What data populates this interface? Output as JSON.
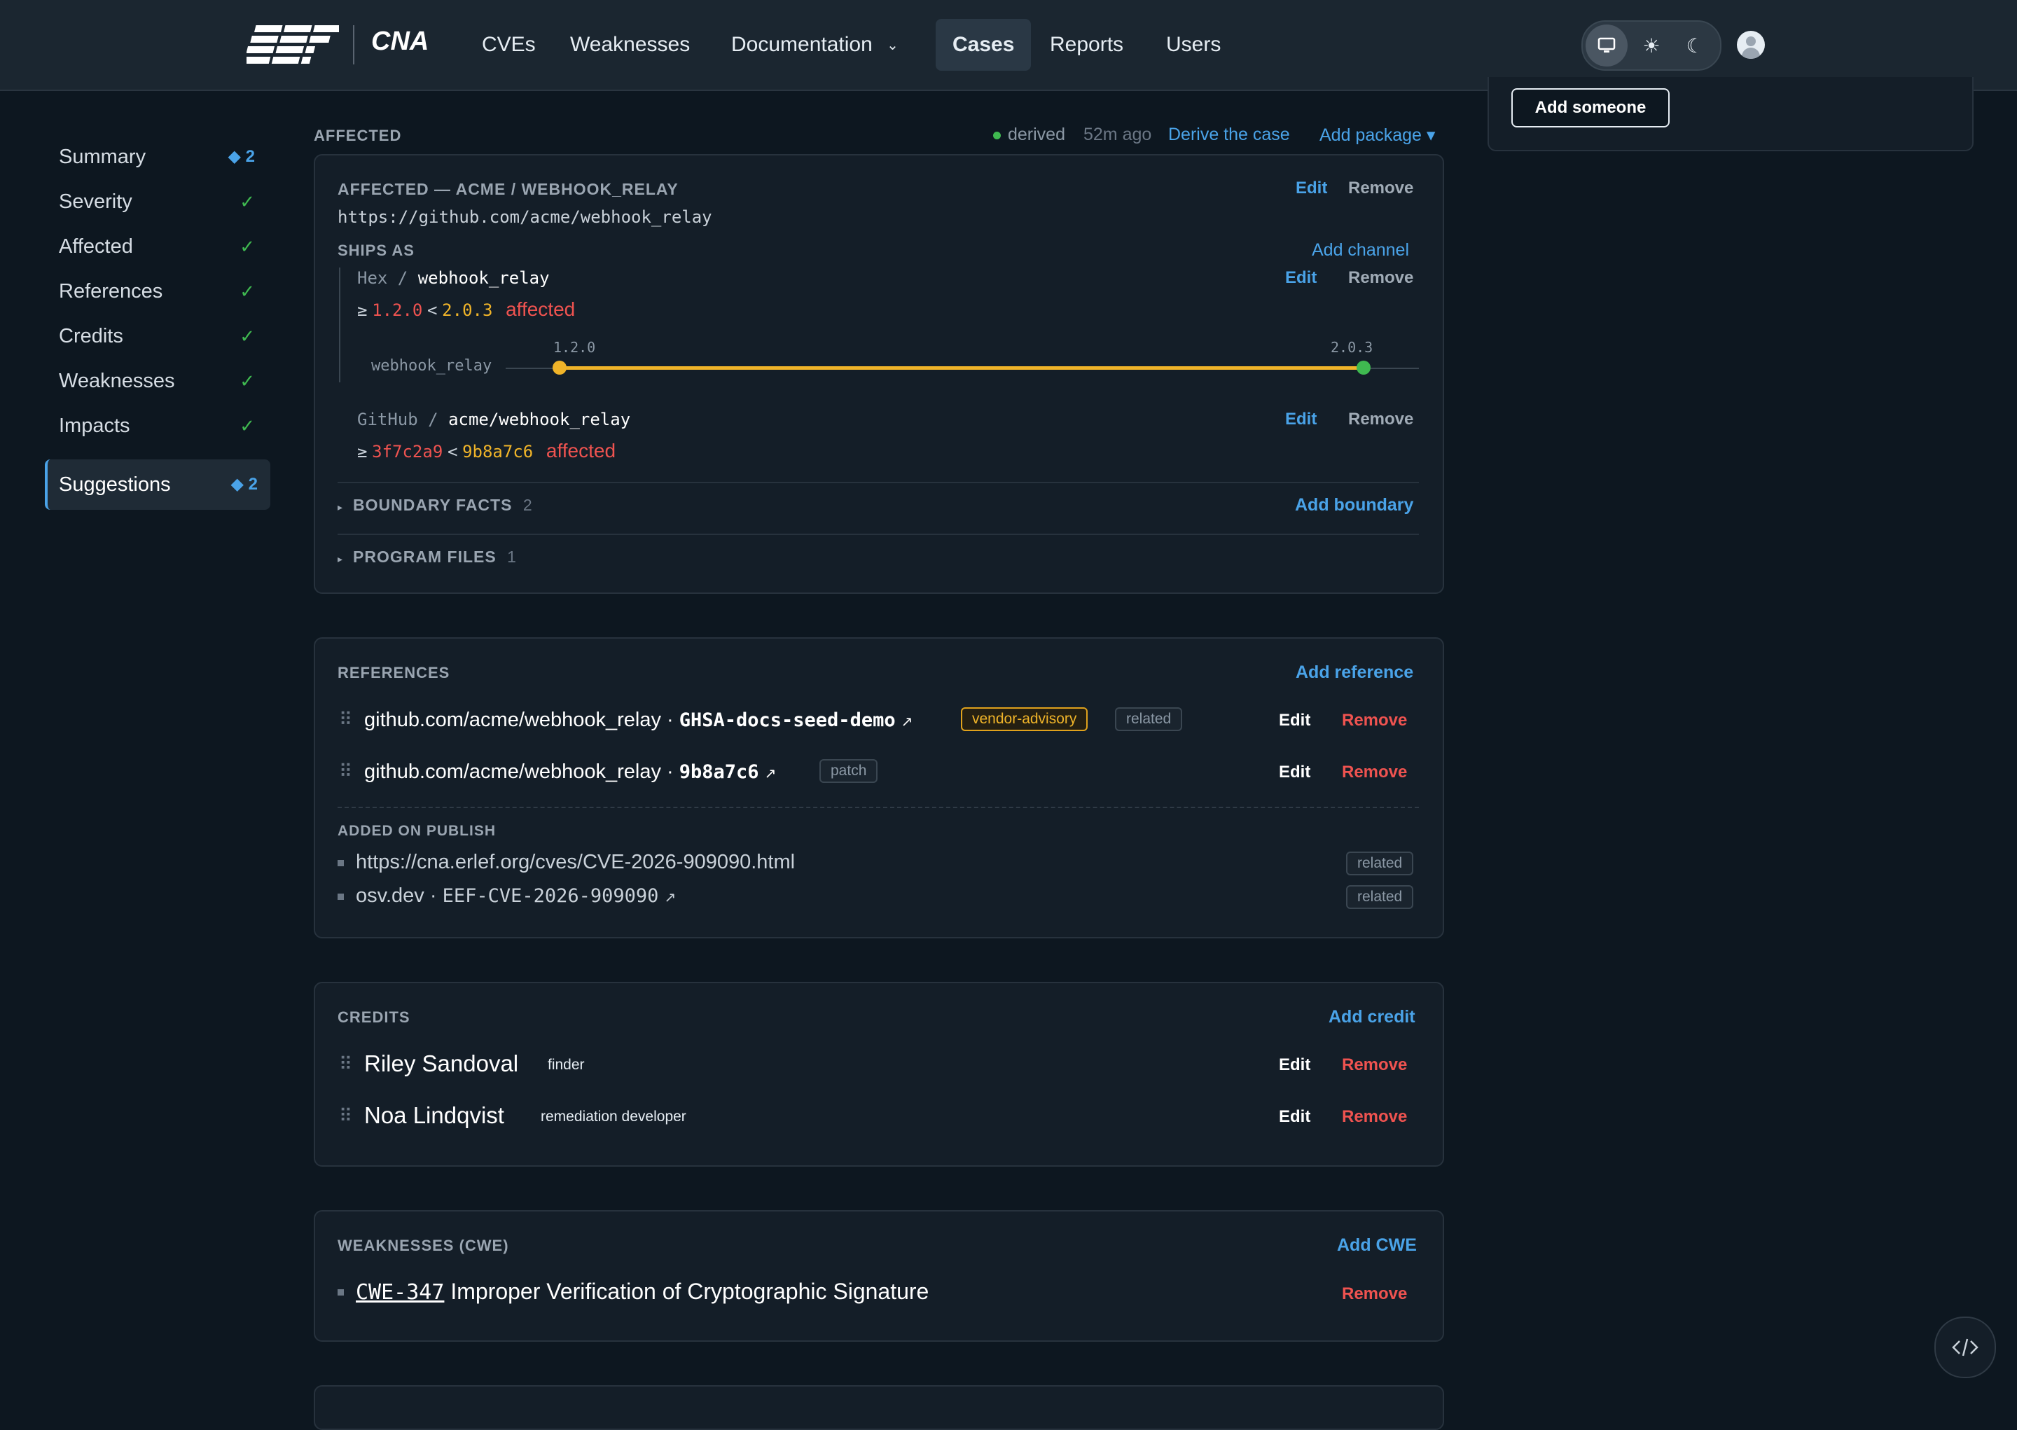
{
  "header": {
    "logo_text": "EEF",
    "brand": "CNA",
    "nav": [
      {
        "label": "CVEs"
      },
      {
        "label": "Weaknesses"
      },
      {
        "label": "Documentation"
      },
      {
        "label": "Cases"
      },
      {
        "label": "Reports"
      },
      {
        "label": "Users"
      }
    ],
    "active_nav": "Cases",
    "theme_options": [
      "monitor-icon",
      "sun-icon",
      "moon-icon"
    ],
    "active_theme": "monitor-icon"
  },
  "sidebar": {
    "items": [
      {
        "label": "Summary",
        "status": "badge",
        "badge": "◆ 2"
      },
      {
        "label": "Severity",
        "status": "check",
        "badge": "✓"
      },
      {
        "label": "Affected",
        "status": "check",
        "badge": "✓"
      },
      {
        "label": "References",
        "status": "check",
        "badge": "✓"
      },
      {
        "label": "Credits",
        "status": "check",
        "badge": "✓"
      },
      {
        "label": "Weaknesses",
        "status": "check",
        "badge": "✓"
      },
      {
        "label": "Impacts",
        "status": "check",
        "badge": "✓"
      }
    ],
    "suggestions": {
      "label": "Suggestions",
      "badge": "◆ 2"
    }
  },
  "right_panel": {
    "add_someone": "Add someone"
  },
  "affected": {
    "section_label": "AFFECTED",
    "derived_status": "derived",
    "derived_time": "52m ago",
    "derive_link": "Derive the case",
    "add_package": "Add package ▾",
    "package_title": "AFFECTED — ACME / WEBHOOK_RELAY",
    "package_url": "https://github.com/acme/webhook_relay",
    "edit": "Edit",
    "remove": "Remove",
    "ships_as": "SHIPS AS",
    "add_channel": "Add channel",
    "channels": [
      {
        "ecosystem": "Hex",
        "sep": " / ",
        "name": "webhook_relay",
        "range_ge": "≥",
        "from": "1.2.0",
        "range_lt": "<",
        "to": "2.0.3",
        "status": "affected"
      },
      {
        "ecosystem": "GitHub",
        "sep": " / ",
        "name": "acme/webhook_relay",
        "range_ge": "≥",
        "from": "3f7c2a9",
        "range_lt": "<",
        "to": "9b8a7c6",
        "status": "affected"
      }
    ],
    "timeline": {
      "label": "webhook_relay",
      "start": "1.2.0",
      "end": "2.0.3"
    },
    "boundary_facts": {
      "label": "BOUNDARY FACTS",
      "count": "2",
      "action": "Add boundary"
    },
    "program_files": {
      "label": "PROGRAM FILES",
      "count": "1"
    }
  },
  "references": {
    "title": "REFERENCES",
    "add": "Add reference",
    "items": [
      {
        "prefix": "github.com/acme/webhook_relay · ",
        "code": "GHSA-docs-seed-demo",
        "arrow": "↗",
        "tags": [
          "vendor-advisory",
          "related"
        ]
      },
      {
        "prefix": "github.com/acme/webhook_relay · ",
        "code": "9b8a7c6",
        "arrow": "↗",
        "tags": [
          "patch"
        ]
      }
    ],
    "edit": "Edit",
    "remove": "Remove",
    "added_on_publish": "ADDED ON PUBLISH",
    "publish_items": [
      {
        "prefix": "https://cna.erlef.org/cves/CVE-2026-909090.html",
        "code": "",
        "arrow": "",
        "tag": "related"
      },
      {
        "prefix": "osv.dev · ",
        "code": "EEF-CVE-2026-909090",
        "arrow": "↗",
        "tag": "related"
      }
    ]
  },
  "credits": {
    "title": "CREDITS",
    "add": "Add credit",
    "items": [
      {
        "name": "Riley Sandoval",
        "role": "finder"
      },
      {
        "name": "Noa Lindqvist",
        "role": "remediation developer"
      }
    ],
    "edit": "Edit",
    "remove": "Remove"
  },
  "weaknesses": {
    "title": "WEAKNESSES (CWE)",
    "add": "Add CWE",
    "items": [
      {
        "id": "CWE-347",
        "name": "Improper Verification of Cryptographic Signature"
      }
    ],
    "remove": "Remove"
  },
  "colors": {
    "accent": "#4aa3e8",
    "danger": "#ef5350",
    "range": "#f0b429",
    "ok": "#3fb950"
  }
}
